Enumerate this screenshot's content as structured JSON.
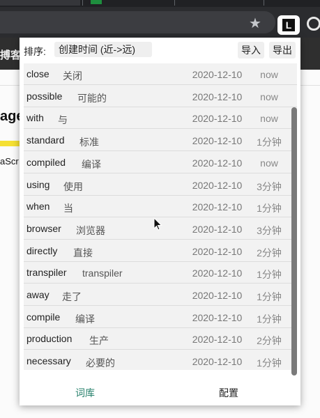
{
  "background_page": {
    "nav_text": "搏客",
    "heading_fragment": "age",
    "js_fragment": "aScr"
  },
  "browser": {
    "star_icon": "star-icon",
    "extension_icon_letter": "L"
  },
  "popup": {
    "sort_label": "排序:",
    "sort_value": "创建时间 (近->远)",
    "import_button": "导入",
    "export_button": "导出",
    "words": [
      {
        "word": "close",
        "meaning": "关闭",
        "date": "2020-12-10",
        "time": "now"
      },
      {
        "word": "possible",
        "meaning": "可能的",
        "date": "2020-12-10",
        "time": "now"
      },
      {
        "word": "with",
        "meaning": "与",
        "date": "2020-12-10",
        "time": "now"
      },
      {
        "word": "standard",
        "meaning": "标准",
        "date": "2020-12-10",
        "time": "1分钟"
      },
      {
        "word": "compiled",
        "meaning": "编译",
        "date": "2020-12-10",
        "time": "now"
      },
      {
        "word": "using",
        "meaning": "使用",
        "date": "2020-12-10",
        "time": "3分钟"
      },
      {
        "word": "when",
        "meaning": "当",
        "date": "2020-12-10",
        "time": "1分钟"
      },
      {
        "word": "browser",
        "meaning": "浏览器",
        "date": "2020-12-10",
        "time": "3分钟"
      },
      {
        "word": "directly",
        "meaning": "直接",
        "date": "2020-12-10",
        "time": "2分钟"
      },
      {
        "word": "transpiler",
        "meaning": "transpiler",
        "date": "2020-12-10",
        "time": "1分钟"
      },
      {
        "word": "away",
        "meaning": "走了",
        "date": "2020-12-10",
        "time": "1分钟"
      },
      {
        "word": "compile",
        "meaning": "编译",
        "date": "2020-12-10",
        "time": "1分钟"
      },
      {
        "word": "production",
        "meaning": "生产",
        "date": "2020-12-10",
        "time": "2分钟"
      },
      {
        "word": "necessary",
        "meaning": "必要的",
        "date": "2020-12-10",
        "time": "1分钟"
      }
    ],
    "footer_tabs": {
      "vocabulary": "词库",
      "settings": "配置"
    }
  },
  "colors": {
    "active_tab": "#26806b",
    "list_background": "#f2f2f2"
  }
}
